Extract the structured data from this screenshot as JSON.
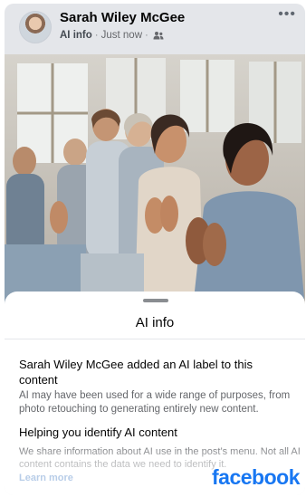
{
  "post": {
    "author": "Sarah Wiley McGee",
    "ai_label": "AI info",
    "separator": "·",
    "time": "Just now",
    "separator2": "·",
    "audience_icon": "friends-icon",
    "more_icon": "ellipsis-icon",
    "more_label": "•••"
  },
  "sheet": {
    "title": "AI info",
    "heading1": "Sarah Wiley McGee added an AI label to this content",
    "body1": "AI may have been used for a wide range of purposes, from photo retouching to generating entirely new content.",
    "heading2": "Helping you identify AI content",
    "body2": "We share information about AI use in the post’s menu. Not all AI content contains the data we need to identify it.",
    "learn_more": "Learn more"
  },
  "brand": {
    "logo_text": "facebook",
    "color": "#1877f2"
  }
}
